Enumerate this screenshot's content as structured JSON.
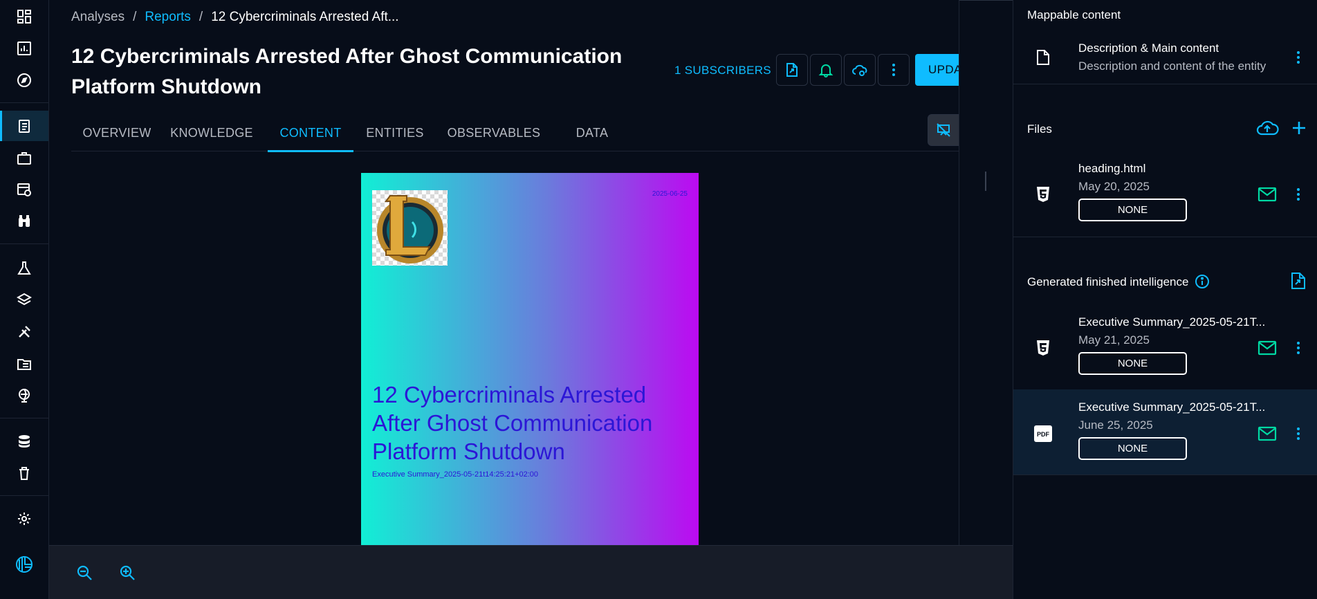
{
  "breadcrumb": {
    "root": "Analyses",
    "parent": "Reports",
    "current": "12 Cybercriminals Arrested Aft..."
  },
  "header": {
    "title": "12 Cybercriminals Arrested After Ghost Communication Platform Shutdown",
    "subscribers": "1 SUBSCRIBERS",
    "update_label": "UPDATE"
  },
  "tabs": [
    {
      "label": "OVERVIEW",
      "active": false
    },
    {
      "label": "KNOWLEDGE",
      "active": false
    },
    {
      "label": "CONTENT",
      "active": true
    },
    {
      "label": "ENTITIES",
      "active": false
    },
    {
      "label": "OBSERVABLES",
      "active": false
    },
    {
      "label": "DATA",
      "active": false
    }
  ],
  "document_preview": {
    "date": "2025-06-25",
    "title": "12 Cybercriminals Arrested After Ghost Communication Platform Shutdown",
    "subtitle": "Executive Summary_2025-05-21t14:25:21+02:00"
  },
  "right_panel": {
    "mappable": {
      "heading": "Mappable content",
      "item_title": "Description & Main content",
      "item_desc": "Description and content of the entity"
    },
    "files": {
      "heading": "Files",
      "items": [
        {
          "name": "heading.html",
          "date": "May 20, 2025",
          "marking": "NONE",
          "icon": "html5-icon"
        }
      ]
    },
    "generated": {
      "heading": "Generated finished intelligence",
      "items": [
        {
          "name": "Executive Summary_2025-05-21T...",
          "date": "May 21, 2025",
          "marking": "NONE",
          "icon": "html5-icon"
        },
        {
          "name": "Executive Summary_2025-05-21T...",
          "date": "June 25, 2025",
          "marking": "NONE",
          "icon": "pdf-icon"
        }
      ]
    }
  },
  "colors": {
    "accent": "#0fbcff",
    "mail": "#00d9a3",
    "background": "#070d19"
  }
}
